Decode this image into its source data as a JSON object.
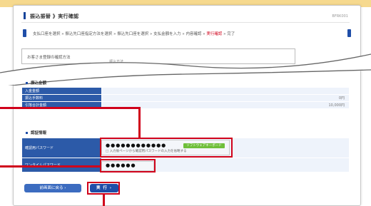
{
  "colors": {
    "accent": "#1f4ea8",
    "highlight": "#d0021b",
    "topbar": "#f6d98e",
    "keyboard_badge": "#6fbf3a"
  },
  "header": {
    "title": "振込振替 》実行確認",
    "screen_id": "BFRK001"
  },
  "steps": {
    "text_before": "支払口座を選択 » 振込先口座指定方法を選択 » 振込先口座を選択 » 支払金額を入力 » 内容確認 » ",
    "current": "実行確認",
    "text_after": " » 完了"
  },
  "input_hint": {
    "label": "お客さま登録の確認方法",
    "sub": "振込方法"
  },
  "sections": {
    "payment": {
      "title": "振込金額",
      "rows": [
        {
          "label": "入金金額",
          "value": ""
        },
        {
          "label": "振込手数料",
          "value": "0円"
        },
        {
          "label": "引落合計金額",
          "value": "10,000円"
        }
      ]
    },
    "auth": {
      "title": "認証情報",
      "confirm_label": "確認用パスワード",
      "confirm_value": "●●●●●●●●●●●●",
      "keyboard_label": "ソフトウェアキーボード",
      "check_label": "入力後ページから確認用パスワードの入力を省略する",
      "onetime_label": "ワンタイムパスワード",
      "onetime_value": "●●●●●●"
    }
  },
  "buttons": {
    "back": "前画面に戻る",
    "execute": "実 行"
  }
}
